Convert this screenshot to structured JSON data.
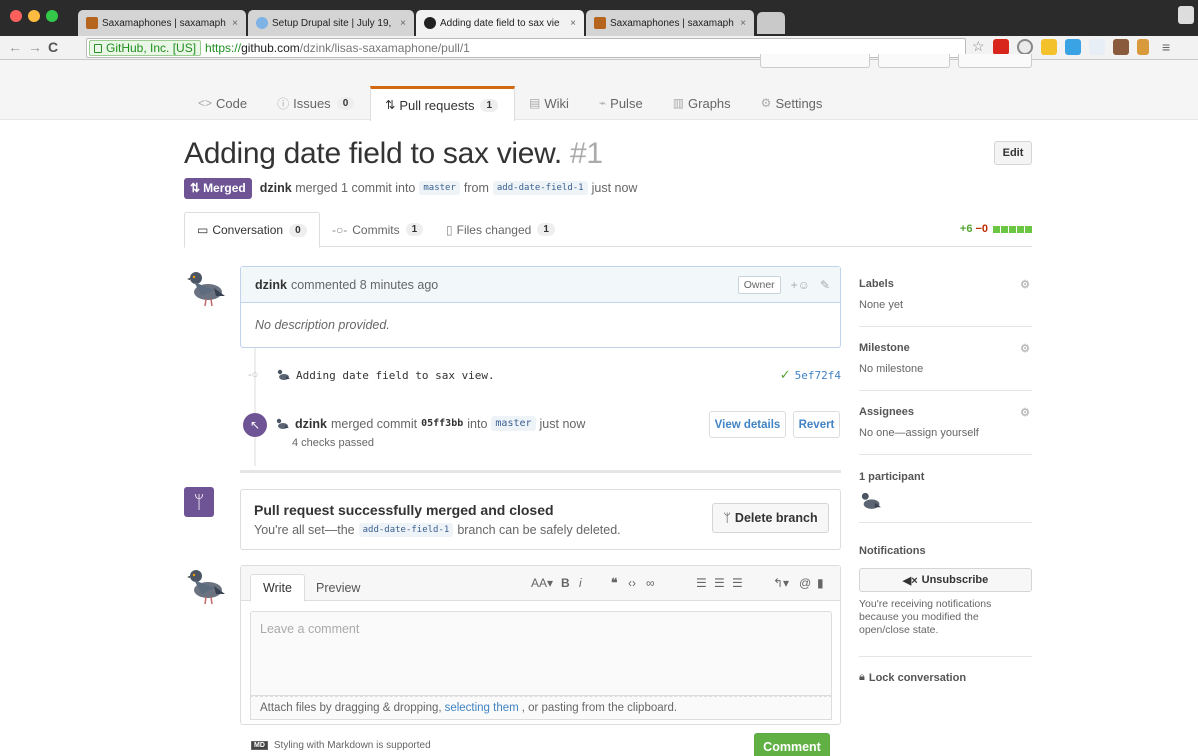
{
  "browser": {
    "tabs": [
      {
        "label": "Saxamaphones | saxamaph",
        "close": "×",
        "fav_color": "#b5651d"
      },
      {
        "label": "Setup Drupal site | July 19,",
        "close": "×",
        "fav_color": "#7fb2e5"
      },
      {
        "label": "Adding date field to sax vie",
        "close": "×",
        "fav_color": "#222222"
      },
      {
        "label": "Saxamaphones | saxamaph",
        "close": "×",
        "fav_color": "#b5651d"
      }
    ],
    "ev_label": "GitHub, Inc. [US]",
    "url_scheme": "https://",
    "url_host": "github.com",
    "url_path": "/dzink/lisas-saxamaphone/pull/1"
  },
  "repo_nav": [
    {
      "icon": "<>",
      "label": "Code",
      "count": ""
    },
    {
      "icon": "ⓘ",
      "label": "Issues",
      "count": "0"
    },
    {
      "icon": "⇅",
      "label": "Pull requests",
      "count": "1"
    },
    {
      "icon": "▤",
      "label": "Wiki",
      "count": ""
    },
    {
      "icon": "⌁",
      "label": "Pulse",
      "count": ""
    },
    {
      "icon": "▥",
      "label": "Graphs",
      "count": ""
    },
    {
      "icon": "⚙",
      "label": "Settings",
      "count": ""
    }
  ],
  "pr": {
    "title": "Adding date field to sax view.",
    "number": "#1",
    "edit_label": "Edit",
    "state_badge": "Merged",
    "author": "dzink",
    "merged_text": "merged 1 commit into",
    "base_branch": "master",
    "from_text": "from",
    "head_branch": "add-date-field-1",
    "time": "just now"
  },
  "pr_tabs": [
    {
      "label": "Conversation",
      "count": "0"
    },
    {
      "label": "Commits",
      "count": "1"
    },
    {
      "label": "Files changed",
      "count": "1"
    }
  ],
  "diffstat": {
    "additions": "+6",
    "deletions": "−0"
  },
  "comment": {
    "author": "dzink",
    "action": "commented 8 minutes ago",
    "owner_label": "Owner",
    "body": "No description provided."
  },
  "commit": {
    "message": "Adding date field to sax view.",
    "sha": "5ef72f4"
  },
  "merge_event": {
    "author": "dzink",
    "text": "merged commit",
    "sha": "05ff3bb",
    "into": "into",
    "branch": "master",
    "time": "just now",
    "checks": "4 checks passed",
    "view_details": "View details",
    "revert": "Revert"
  },
  "merged_box": {
    "title": "Pull request successfully merged and closed",
    "sub_before": "You're all set—the",
    "branch": "add-date-field-1",
    "sub_after": "branch can be safely deleted.",
    "delete_label": "Delete branch"
  },
  "compose": {
    "write_tab": "Write",
    "preview_tab": "Preview",
    "placeholder": "Leave a comment",
    "attach_before": "Attach files by dragging & dropping,",
    "attach_link": "selecting them",
    "attach_after": ", or pasting from the clipboard.",
    "md_badge": "MD",
    "md_hint": "Styling with Markdown is supported",
    "submit": "Comment"
  },
  "sidebar": {
    "labels_head": "Labels",
    "labels_val": "None yet",
    "milestone_head": "Milestone",
    "milestone_val": "No milestone",
    "assignees_head": "Assignees",
    "assignees_val": "No one—assign yourself",
    "participants_head": "1 participant",
    "notifications_head": "Notifications",
    "unsubscribe": "Unsubscribe",
    "notif_note": "You're receiving notifications because you modified the open/close state.",
    "lock": "Lock conversation"
  },
  "colors": {
    "merged_purple": "#6e5494",
    "active_tab_accent": "#d26911",
    "link_blue": "#4183c4",
    "success_green": "#60b044"
  }
}
